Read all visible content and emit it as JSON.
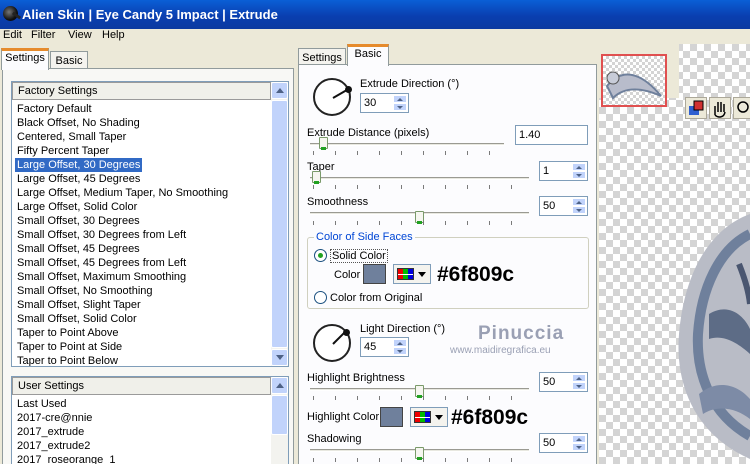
{
  "window": {
    "title": "Alien Skin | Eye Candy 5 Impact | Extrude"
  },
  "menu": [
    "Edit",
    "Filter",
    "View",
    "Help"
  ],
  "left_tabs": [
    "Settings",
    "Basic"
  ],
  "factory": {
    "header": "Factory Settings",
    "items": [
      "Factory Default",
      "Black Offset, No Shading",
      "Centered, Small Taper",
      "Fifty Percent Taper",
      "Large Offset, 30 Degrees",
      "Large Offset, 45 Degrees",
      "Large Offset, Medium Taper, No Smoothing",
      "Large Offset, Solid Color",
      "Small Offset, 30 Degrees",
      "Small Offset, 30 Degrees from Left",
      "Small Offset, 45 Degrees",
      "Small Offset, 45 Degrees from Left",
      "Small Offset, Maximum Smoothing",
      "Small Offset, No Smoothing",
      "Small Offset, Slight Taper",
      "Small Offset, Solid Color",
      "Taper to Point Above",
      "Taper to Point at Side",
      "Taper to Point Below"
    ],
    "selected": "Large Offset, 30 Degrees"
  },
  "user": {
    "header": "User Settings",
    "items": [
      "Last Used",
      "2017-cre@nnie",
      "2017_extrude",
      "2017_extrude2",
      "2017_roseorange_1"
    ]
  },
  "mid_tabs": [
    "Settings",
    "Basic"
  ],
  "basic": {
    "extrude_direction": {
      "label": "Extrude Direction (°)",
      "value": "30"
    },
    "extrude_distance": {
      "label": "Extrude Distance (pixels)",
      "value": "1.40",
      "level": 0.05
    },
    "taper": {
      "label": "Taper",
      "value": "1",
      "level": 0.01
    },
    "smoothness": {
      "label": "Smoothness",
      "value": "50",
      "level": 0.5
    },
    "side_faces": {
      "group_label": "Color of Side Faces",
      "solid_label": "Solid Color",
      "color_label": "Color",
      "original_label": "Color from Original",
      "color_hex": "#6f809c"
    },
    "light_direction": {
      "label": "Light Direction (°)",
      "value": "45"
    },
    "highlight_brightness": {
      "label": "Highlight Brightness",
      "value": "50",
      "level": 0.5
    },
    "highlight_color": {
      "label": "Highlight Color",
      "color_hex": "#6f809c"
    },
    "shadowing": {
      "label": "Shadowing",
      "value": "50",
      "level": 0.5
    }
  },
  "watermark": {
    "name": "Pinuccia",
    "url": "www.maidiregrafica.eu"
  },
  "colors": {
    "swatch": "#6f809c",
    "selection": "#316ac5",
    "title_bar": "#0a5fd6",
    "tab_accent": "#e68b2c"
  },
  "icons": [
    "app-icon",
    "color-picker-icon",
    "hand-tool-icon",
    "zoom-tool-icon"
  ]
}
